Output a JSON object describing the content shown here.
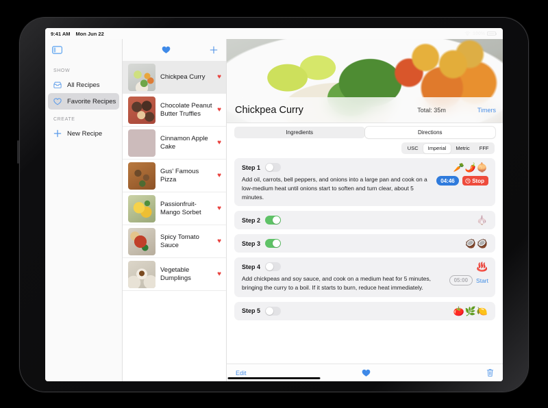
{
  "statusbar": {
    "time": "9:41 AM",
    "date": "Mon Jun 22",
    "battery_percent": "100%",
    "wifi_icon": "wifi-icon"
  },
  "sidebar": {
    "toggle_icon": "sidebar-toggle-icon",
    "sections": [
      {
        "title": "SHOW",
        "items": [
          {
            "label": "All Recipes",
            "icon": "inbox-icon",
            "active": false
          },
          {
            "label": "Favorite Recipes",
            "icon": "heart-outline-icon",
            "active": true
          }
        ]
      },
      {
        "title": "CREATE",
        "items": [
          {
            "label": "New Recipe",
            "icon": "plus-icon",
            "active": false
          }
        ]
      }
    ]
  },
  "list": {
    "toolbar": {
      "heart_icon": "heart-filled-icon",
      "add_icon": "plus-icon"
    },
    "rows": [
      {
        "title": "Chickpea Curry",
        "favorite": true,
        "selected": true,
        "thumb": "ph-curry"
      },
      {
        "title": "Chocolate Peanut Butter Truffles",
        "favorite": true,
        "selected": false,
        "thumb": "ph-truffle"
      },
      {
        "title": "Cinnamon Apple Cake",
        "favorite": true,
        "selected": false,
        "thumb": "ph-cake"
      },
      {
        "title": "Gus' Famous Pizza",
        "favorite": true,
        "selected": false,
        "thumb": "ph-pizza"
      },
      {
        "title": "Passionfruit-Mango Sorbet",
        "favorite": true,
        "selected": false,
        "thumb": "ph-sorbet"
      },
      {
        "title": "Spicy Tomato Sauce",
        "favorite": true,
        "selected": false,
        "thumb": "ph-sauce"
      },
      {
        "title": "Vegetable Dumplings",
        "favorite": true,
        "selected": false,
        "thumb": "ph-dump"
      }
    ]
  },
  "detail": {
    "hero_image_alt": "chickpea-curry-bowl",
    "title": "Chickpea Curry",
    "total_time": "Total: 35m",
    "timers_link": "Timers",
    "tabs": [
      {
        "label": "Ingredients",
        "selected": false
      },
      {
        "label": "Directions",
        "selected": true
      }
    ],
    "units": [
      {
        "label": "USC",
        "selected": false
      },
      {
        "label": "Imperial",
        "selected": true
      },
      {
        "label": "Metric",
        "selected": false
      },
      {
        "label": "FFF",
        "selected": false
      }
    ],
    "steps": [
      {
        "label": "Step 1",
        "done": false,
        "emoji": "🥕🌶️🧅",
        "text": "Add oil, carrots, bell peppers, and onions into a large pan and cook on a low-medium heat until onions start to soften and turn clear, about 5 minutes.",
        "timer": {
          "state": "running",
          "value": "04:46",
          "action": "Stop",
          "action_icon": "stopwatch-icon"
        }
      },
      {
        "label": "Step 2",
        "done": true,
        "emoji": "🧄",
        "text": "",
        "timer": null
      },
      {
        "label": "Step 3",
        "done": true,
        "emoji": "🥥🥥",
        "text": "",
        "timer": null
      },
      {
        "label": "Step 4",
        "done": false,
        "emoji": "♨️",
        "text": "Add chickpeas and soy sauce, and cook on a medium heat for 5 minutes, bringing the curry to a boil. If it starts to burn, reduce heat immediately.",
        "timer": {
          "state": "idle",
          "value": "05:00",
          "action": "Start",
          "action_icon": ""
        }
      },
      {
        "label": "Step 5",
        "done": false,
        "emoji": "🍅🌿🍋",
        "text": "",
        "timer": null
      }
    ],
    "bottombar": {
      "edit_label": "Edit",
      "favorite_icon": "heart-filled-icon",
      "delete_icon": "trash-icon"
    }
  },
  "colors": {
    "accent_blue": "#4a8fe6",
    "timer_blue": "#2f7bdc",
    "stop_red": "#ee4b3c",
    "favorite_red": "#e8433f",
    "toggle_green": "#5fc267"
  }
}
